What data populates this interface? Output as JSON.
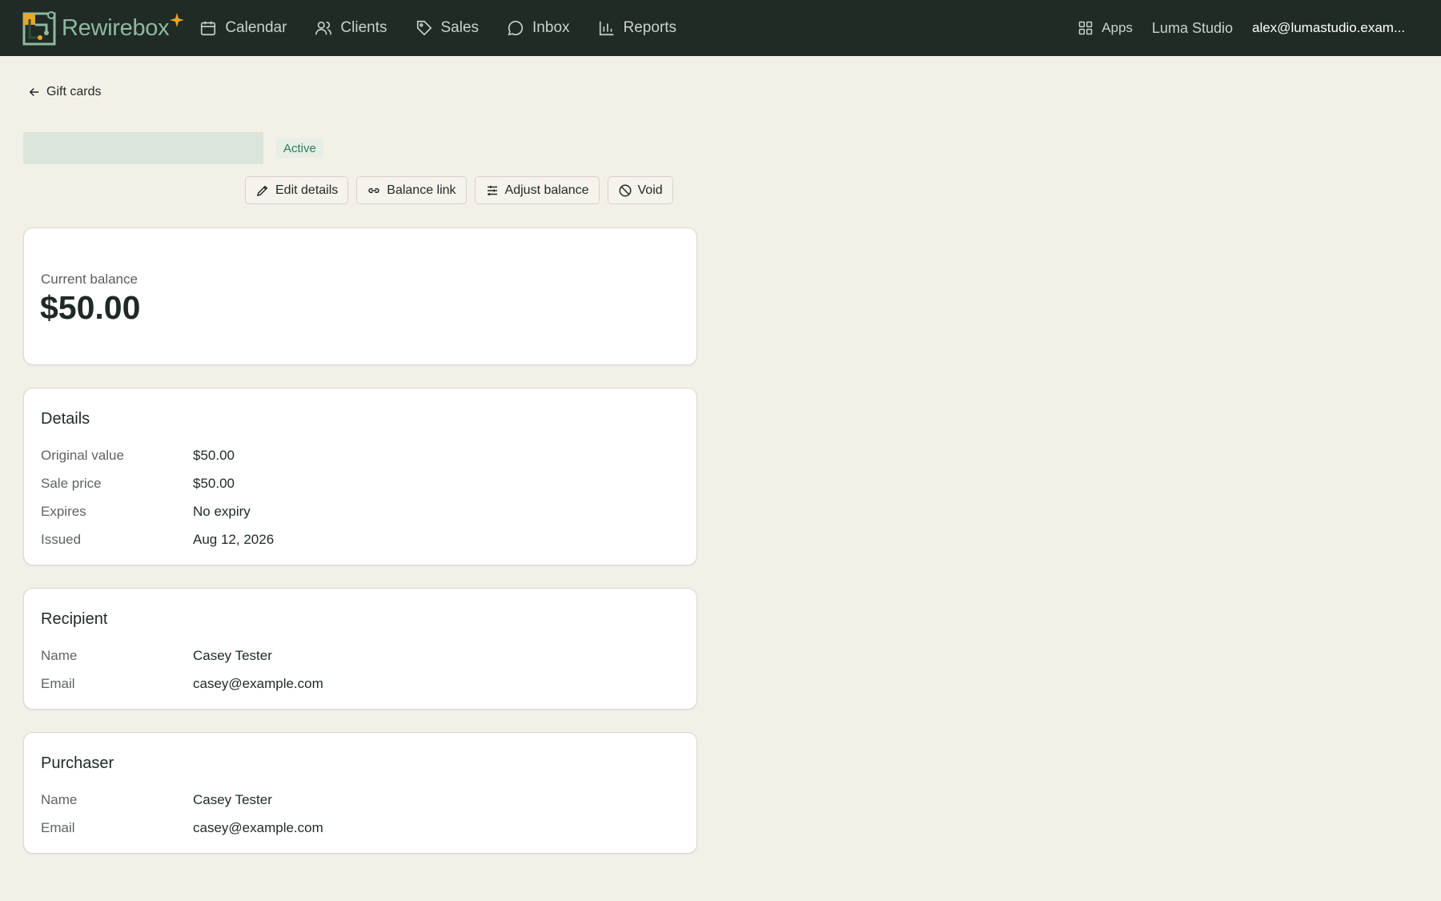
{
  "app": {
    "name": "Rewirebox",
    "nav": [
      {
        "label": "Calendar",
        "icon": "calendar-icon"
      },
      {
        "label": "Clients",
        "icon": "users-icon"
      },
      {
        "label": "Sales",
        "icon": "tag-icon"
      },
      {
        "label": "Inbox",
        "icon": "chat-icon"
      },
      {
        "label": "Reports",
        "icon": "bar-chart-icon"
      }
    ],
    "apps_label": "Apps",
    "studio": "Luma Studio",
    "user_email": "alex@lumastudio.exam..."
  },
  "page": {
    "back_label": "Gift cards",
    "status": "Active",
    "actions": {
      "edit": "Edit details",
      "balance_link": "Balance link",
      "adjust": "Adjust balance",
      "void": "Void"
    }
  },
  "balance": {
    "label": "Current balance",
    "value": "$50.00"
  },
  "details": {
    "title": "Details",
    "rows": [
      {
        "key": "Original value",
        "value": "$50.00"
      },
      {
        "key": "Sale price",
        "value": "$50.00"
      },
      {
        "key": "Expires",
        "value": "No expiry"
      },
      {
        "key": "Issued",
        "value": "Aug 12, 2026"
      }
    ]
  },
  "recipient": {
    "title": "Recipient",
    "rows": [
      {
        "key": "Name",
        "value": "Casey Tester"
      },
      {
        "key": "Email",
        "value": "casey@example.com"
      }
    ]
  },
  "purchaser": {
    "title": "Purchaser",
    "rows": [
      {
        "key": "Name",
        "value": "Casey Tester"
      },
      {
        "key": "Email",
        "value": "casey@example.com"
      }
    ]
  },
  "colors": {
    "topbar": "#1f2b24",
    "background": "#f3f0e8",
    "accent": "#e8a62a",
    "active_badge": "#2e7d55"
  }
}
